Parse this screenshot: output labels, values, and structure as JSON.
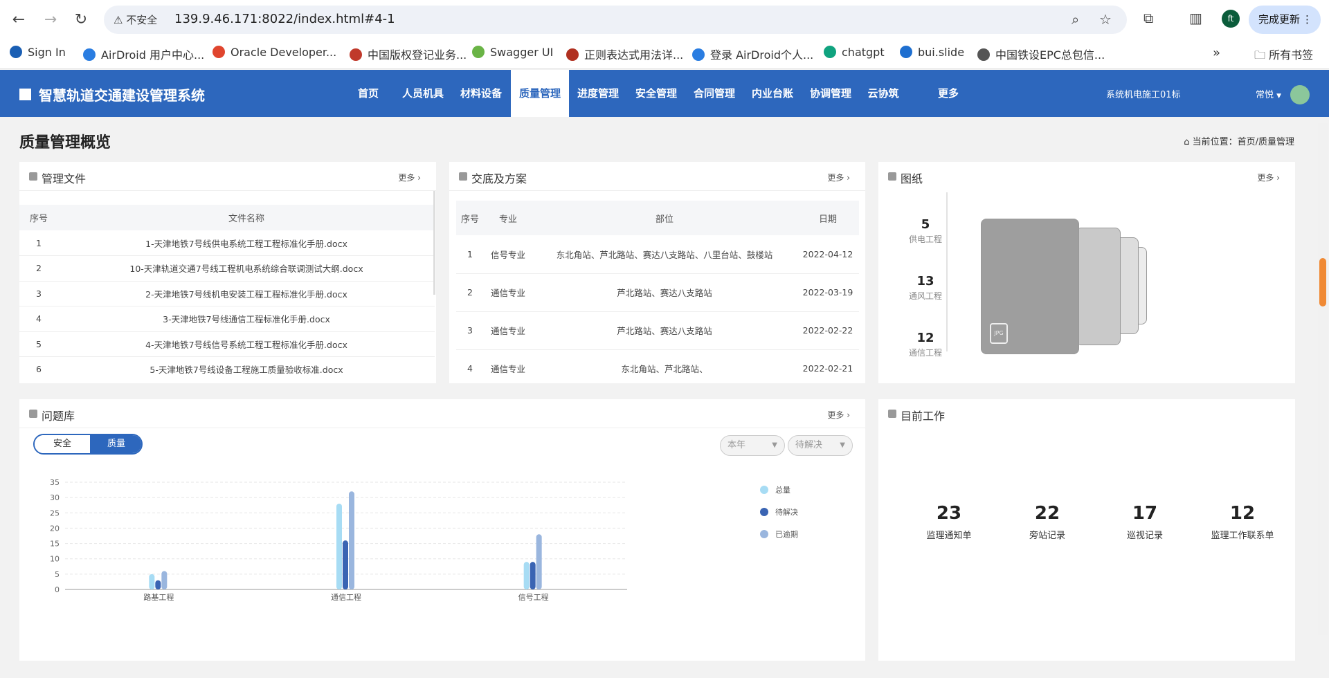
{
  "browser": {
    "insecure_label": "不安全",
    "url": "139.9.46.171:8022/index.html#4-1",
    "update_label": "完成更新",
    "profile_initials": "ft",
    "bookmarks": [
      {
        "label": "Sign In",
        "color": "#1a5fb4"
      },
      {
        "label": "AirDroid 用户中心...",
        "color": "#2a7de1"
      },
      {
        "label": "Oracle Developer...",
        "color": "#e0452e"
      },
      {
        "label": "中国版权登记业务...",
        "color": "#c0392b"
      },
      {
        "label": "Swagger UI",
        "color": "#6ab446"
      },
      {
        "label": "正则表达式用法详...",
        "color": "#b03020"
      },
      {
        "label": "登录 AirDroid个人...",
        "color": "#2a7de1"
      },
      {
        "label": "chatgpt",
        "color": "#10a37f"
      },
      {
        "label": "bui.slide",
        "color": "#1e6fd0"
      },
      {
        "label": "中国铁设EPC总包信...",
        "color": "#555"
      }
    ],
    "all_bookmarks": "所有书签"
  },
  "app": {
    "title": "智慧轨道交通建设管理系统",
    "menu": [
      "首页",
      "人员机具",
      "材料设备",
      "质量管理",
      "进度管理",
      "安全管理",
      "合同管理",
      "内业台账",
      "协调管理",
      "云协筑",
      "更多"
    ],
    "active_menu_index": 3,
    "tenant": "系统机电施工01标",
    "user": "常悦"
  },
  "page": {
    "title": "质量管理概览",
    "crumb_prefix": "当前位置：",
    "crumb": "首页/质量管理"
  },
  "files": {
    "title": "管理文件",
    "more": "更多",
    "headers": [
      "序号",
      "文件名称"
    ],
    "rows": [
      [
        "1",
        "1-天津地铁7号线供电系统工程工程标准化手册.docx"
      ],
      [
        "2",
        "10-天津轨道交通7号线工程机电系统综合联调测试大纲.docx"
      ],
      [
        "3",
        "2-天津地铁7号线机电安装工程工程标准化手册.docx"
      ],
      [
        "4",
        "3-天津地铁7号线通信工程标准化手册.docx"
      ],
      [
        "5",
        "4-天津地铁7号线信号系统工程工程标准化手册.docx"
      ],
      [
        "6",
        "5-天津地铁7号线设备工程施工质量验收标准.docx"
      ]
    ]
  },
  "plans": {
    "title": "交底及方案",
    "more": "更多",
    "headers": [
      "序号",
      "专业",
      "部位",
      "日期"
    ],
    "rows": [
      [
        "1",
        "信号专业",
        "东北角站、芦北路站、赛达八支路站、八里台站、鼓楼站",
        "2022-04-12"
      ],
      [
        "2",
        "通信专业",
        "芦北路站、赛达八支路站",
        "2022-03-19"
      ],
      [
        "3",
        "通信专业",
        "芦北路站、赛达八支路站",
        "2022-02-22"
      ],
      [
        "4",
        "通信专业",
        "东北角站、芦北路站、",
        "2022-02-21"
      ]
    ]
  },
  "drawings": {
    "title": "图纸",
    "more": "更多",
    "stats": [
      {
        "value": "5",
        "label": "供电工程"
      },
      {
        "value": "13",
        "label": "通风工程"
      },
      {
        "value": "12",
        "label": "通信工程"
      }
    ],
    "file_badge": "JPG"
  },
  "issues": {
    "title": "问题库",
    "more": "更多",
    "toggle": [
      "安全",
      "质量"
    ],
    "toggle_active": 1,
    "filter_year": "本年",
    "filter_status": "待解决",
    "legend": [
      {
        "label": "总量",
        "color": "#a7dcf4"
      },
      {
        "label": "待解决",
        "color": "#3a64b3"
      },
      {
        "label": "已逾期",
        "color": "#9ab6de"
      }
    ]
  },
  "chart_data": {
    "type": "bar",
    "categories": [
      "路基工程",
      "通信工程",
      "信号工程"
    ],
    "series": [
      {
        "name": "总量",
        "values": [
          5,
          28,
          9
        ],
        "color": "#a7dcf4"
      },
      {
        "name": "待解决",
        "values": [
          3,
          16,
          9
        ],
        "color": "#3a64b3"
      },
      {
        "name": "已逾期",
        "values": [
          6,
          32,
          18
        ],
        "color": "#9ab6de"
      }
    ],
    "ylim": [
      0,
      35
    ],
    "yticks": [
      0,
      5,
      10,
      15,
      20,
      25,
      30,
      35
    ],
    "grid": true,
    "legend_position": "right"
  },
  "work": {
    "title": "目前工作",
    "stats": [
      {
        "value": "23",
        "label": "监理通知单"
      },
      {
        "value": "22",
        "label": "旁站记录"
      },
      {
        "value": "17",
        "label": "巡视记录"
      },
      {
        "value": "12",
        "label": "监理工作联系单"
      }
    ]
  }
}
